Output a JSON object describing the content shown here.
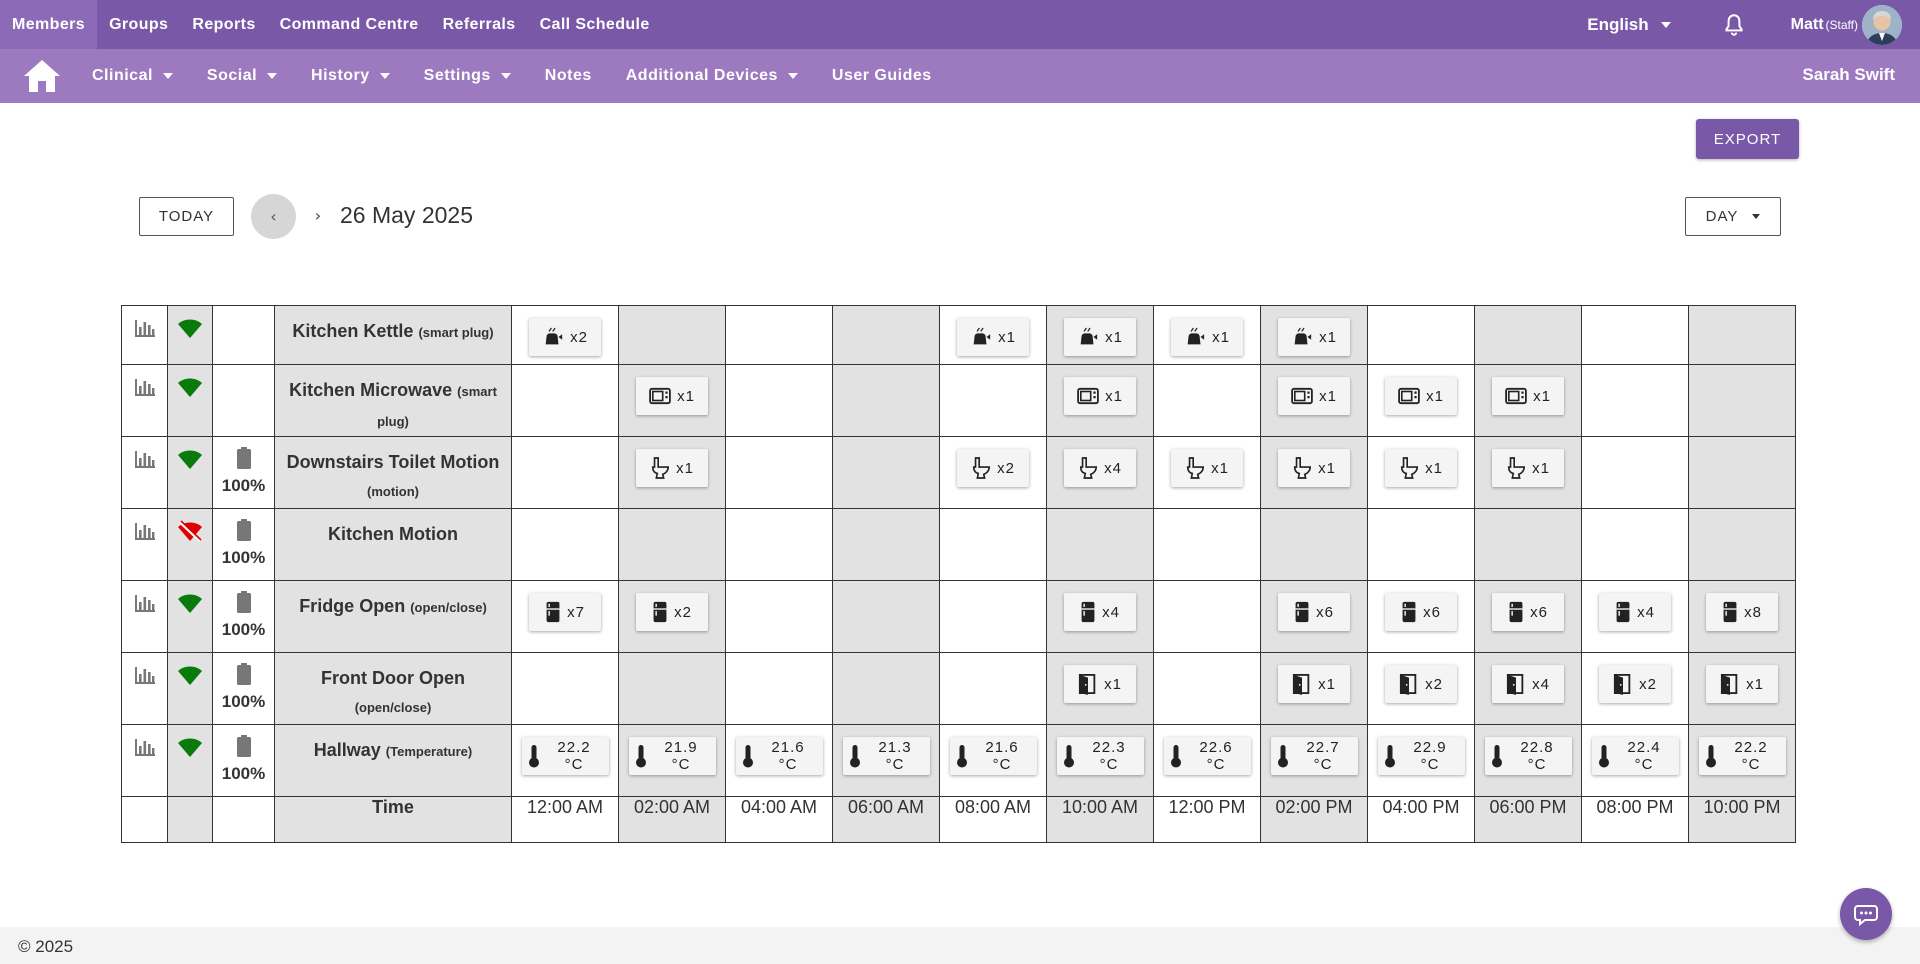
{
  "topnav": {
    "items": [
      "Members",
      "Groups",
      "Reports",
      "Command Centre",
      "Referrals",
      "Call Schedule"
    ],
    "active_index": 0
  },
  "topright": {
    "language": "English",
    "user_name": "Matt",
    "user_role": "(Staff)"
  },
  "subnav": {
    "items": [
      {
        "label": "Clinical",
        "dropdown": true
      },
      {
        "label": "Social",
        "dropdown": true
      },
      {
        "label": "History",
        "dropdown": true
      },
      {
        "label": "Settings",
        "dropdown": true
      },
      {
        "label": "Notes",
        "dropdown": false
      },
      {
        "label": "Additional Devices",
        "dropdown": true
      },
      {
        "label": "User Guides",
        "dropdown": false
      }
    ],
    "member_name": "Sarah Swift"
  },
  "toolbar": {
    "export_label": "EXPORT",
    "today_label": "TODAY",
    "prev_symbol": "‹",
    "next_symbol": "›",
    "date": "26 May 2025",
    "view_label": "DAY"
  },
  "colors": {
    "brand": "#7a58a8",
    "brand_light": "#9d7ac0",
    "signal_ok": "#0a7a0a",
    "signal_lost": "#e00000"
  },
  "devices": [
    {
      "name": "Kitchen Kettle",
      "type": "(smart plug)",
      "signal": "ok",
      "battery": "",
      "icon": "kettle-icon",
      "cells": [
        "x2",
        "",
        "",
        "",
        "x1",
        "x1",
        "x1",
        "x1",
        "",
        "",
        "",
        ""
      ]
    },
    {
      "name": "Kitchen Microwave",
      "type": "(smart plug)",
      "signal": "ok",
      "battery": "",
      "icon": "microwave-icon",
      "cells": [
        "",
        "x1",
        "",
        "",
        "",
        "x1",
        "",
        "x1",
        "x1",
        "x1",
        "",
        ""
      ]
    },
    {
      "name": "Downstairs Toilet Motion",
      "type": "(motion)",
      "signal": "ok",
      "battery": "100%",
      "icon": "toilet-icon",
      "cells": [
        "",
        "x1",
        "",
        "",
        "x2",
        "x4",
        "x1",
        "x1",
        "x1",
        "x1",
        "",
        ""
      ]
    },
    {
      "name": "Kitchen Motion",
      "type": "",
      "signal": "lost",
      "battery": "100%",
      "icon": "motion-icon",
      "cells": [
        "",
        "",
        "",
        "",
        "",
        "",
        "",
        "",
        "",
        "",
        "",
        ""
      ]
    },
    {
      "name": "Fridge Open",
      "type": "(open/close)",
      "signal": "ok",
      "battery": "100%",
      "icon": "fridge-icon",
      "cells": [
        "x7",
        "x2",
        "",
        "",
        "",
        "x4",
        "",
        "x6",
        "x6",
        "x6",
        "x4",
        "x8"
      ]
    },
    {
      "name": "Front Door Open",
      "type": "(open/close)",
      "signal": "ok",
      "battery": "100%",
      "icon": "door-icon",
      "cells": [
        "",
        "",
        "",
        "",
        "",
        "x1",
        "",
        "x1",
        "x2",
        "x4",
        "x2",
        "x1"
      ]
    },
    {
      "name": "Hallway",
      "type": "(Temperature)",
      "signal": "ok",
      "battery": "100%",
      "icon": "thermometer-icon",
      "cells": [
        "22.2 °C",
        "21.9 °C",
        "21.6 °C",
        "21.3 °C",
        "21.6 °C",
        "22.3 °C",
        "22.6 °C",
        "22.7 °C",
        "22.9 °C",
        "22.8 °C",
        "22.4 °C",
        "22.2 °C"
      ]
    }
  ],
  "time_row": {
    "label": "Time",
    "slots": [
      "12:00 AM",
      "02:00 AM",
      "04:00 AM",
      "06:00 AM",
      "08:00 AM",
      "10:00 AM",
      "12:00 PM",
      "02:00 PM",
      "04:00 PM",
      "06:00 PM",
      "08:00 PM",
      "10:00 PM"
    ]
  },
  "footer": {
    "copyright": "© 2025"
  }
}
